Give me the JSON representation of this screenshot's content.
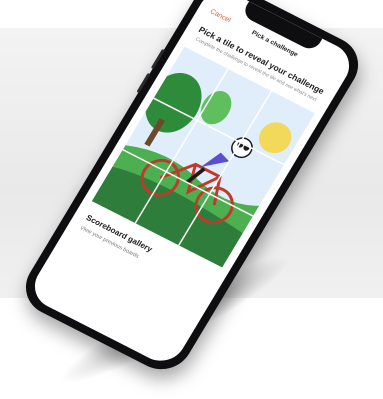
{
  "screen": {
    "back_label": "Cancel",
    "bar_title": "Pick a challenge",
    "heading": "Pick a tile to reveal your challenge",
    "subheading": "Complete the challenge to reveal the tile and see what's next",
    "gallery_title": "Scoreboard gallery",
    "gallery_sub": "View your previous boards"
  },
  "colors": {
    "accent": "#e0613a",
    "sky": "#dfeefa",
    "grass": "#4caf50",
    "tree": "#2e8b3a",
    "sun": "#f2d95a",
    "bike": "#c0392b",
    "jersey": "#5a4fcf"
  },
  "puzzle": {
    "rows": 3,
    "cols": 3,
    "illustration": "cyclist-icon"
  }
}
